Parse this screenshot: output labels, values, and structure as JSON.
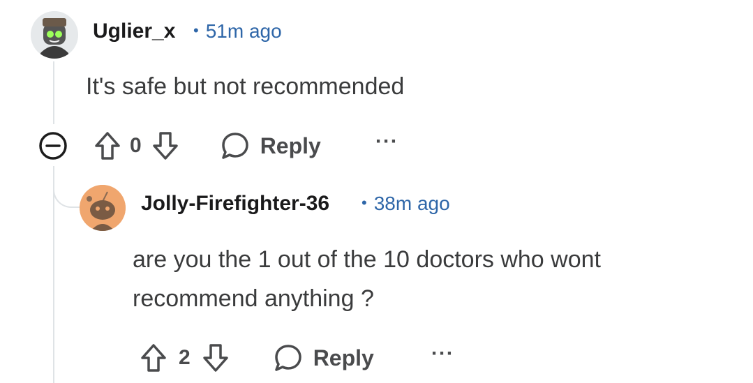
{
  "comments": [
    {
      "author": "Uglier_x",
      "separator": "•",
      "time": "51m ago",
      "body": "It's safe but not recommended",
      "votes": "0",
      "reply_label": "Reply",
      "more_label": "···",
      "avatar_icon": "robot-avatar-icon"
    },
    {
      "author": "Jolly-Firefighter-36",
      "separator": "•",
      "time": "38m ago",
      "body": "are you the 1 out of the 10 doctors who wont recommend anything ?",
      "votes": "2",
      "reply_label": "Reply",
      "more_label": "···",
      "avatar_icon": "snoo-avatar-icon"
    }
  ],
  "colors": {
    "meta": "#2e66a8",
    "text": "#3a3b3c",
    "thread_line": "#dfe3e6",
    "avatar_2_bg": "#f0a66e"
  }
}
